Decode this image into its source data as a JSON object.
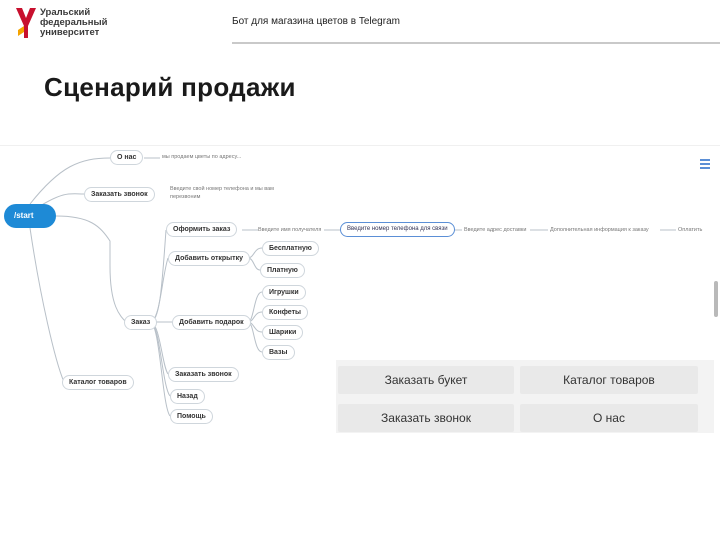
{
  "header": {
    "logo_lines": [
      "Уральский",
      "федеральный",
      "университет"
    ],
    "title": "Бот для магазина цветов в Telegram",
    "brand_color": "#c8102e"
  },
  "slide": {
    "title": "Сценарий продажи"
  },
  "mindmap": {
    "start": "/start",
    "about": {
      "label": "О нас",
      "desc": "мы продаем цветы по адресу..."
    },
    "call": {
      "label": "Заказать звонок",
      "desc": [
        "Введите свой номер телефона и мы вам",
        "перезвоним"
      ]
    },
    "order": {
      "label": "Заказ",
      "checkout": "Оформить заказ",
      "flow": [
        "Введите имя получателя",
        "Введите номер телефона для связи",
        "Введите адрес доставки",
        "Дополнительная информация к заказу",
        "Оплатить"
      ],
      "add_card": "Добавить открытку",
      "card_options": [
        "Бесплатную",
        "Платную"
      ],
      "add_gift": "Добавить подарок",
      "gifts": [
        "Игрушки",
        "Конфеты",
        "Шарики",
        "Вазы"
      ],
      "order_call": "Заказать звонок",
      "back": "Назад",
      "help": "Помощь"
    },
    "catalog": "Каталог товаров",
    "accent_color": "#1e8ad6"
  },
  "keyboard": {
    "buttons": [
      "Заказать букет",
      "Каталог товаров",
      "Заказать звонок",
      "О нас"
    ]
  },
  "icons": {
    "menu": "hamburger-menu-icon"
  }
}
